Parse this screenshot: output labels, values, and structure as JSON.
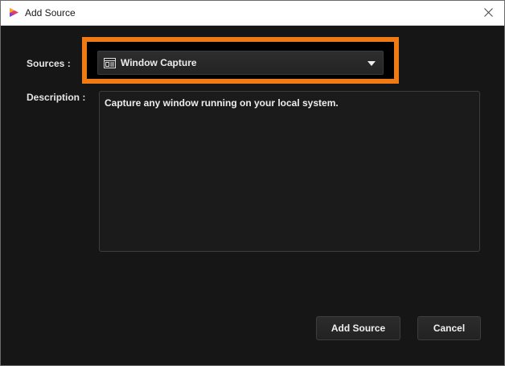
{
  "window": {
    "title": "Add Source",
    "icons": {
      "app": "app-logo-icon",
      "close": "close-icon"
    }
  },
  "form": {
    "sources_label": "Sources :",
    "selected_source": "Window Capture",
    "selected_source_icon": "window-capture-icon",
    "description_label": "Description :",
    "description_text": "Capture any window running on your local system."
  },
  "buttons": {
    "add_label": "Add Source",
    "cancel_label": "Cancel"
  },
  "colors": {
    "highlight": "#f07a14",
    "background": "#161616",
    "titlebar": "#ffffff"
  }
}
